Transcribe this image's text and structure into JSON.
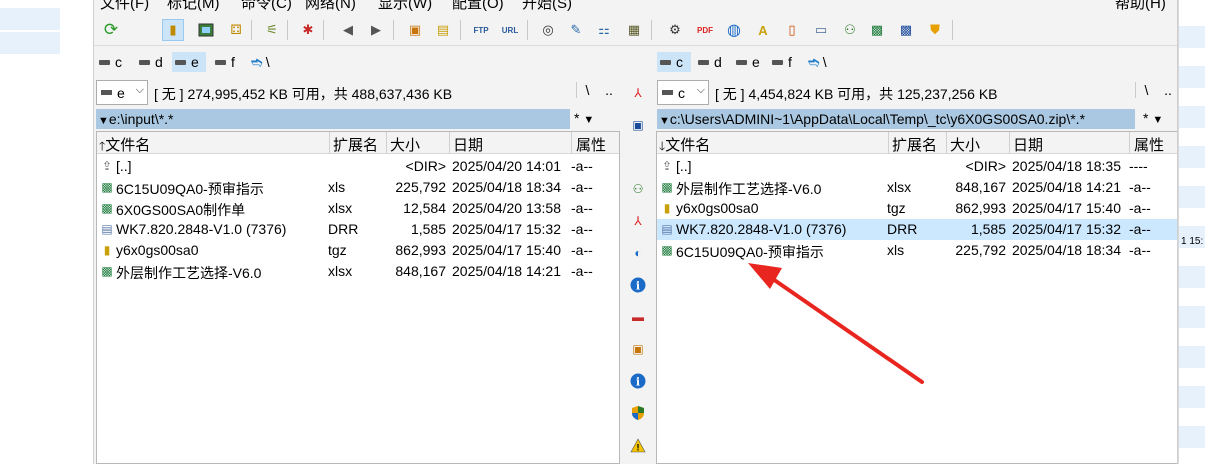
{
  "menu": [
    "文件(F)",
    "标记(M)",
    "命令(C)",
    "网络(N)",
    "显示(W)",
    "配置(O)",
    "开始(S)",
    "帮助(H)"
  ],
  "toolbar_icons": [
    "refresh-icon",
    "view-toggle-icon",
    "thumbnail-icon",
    "tree-icon",
    "compare-icon",
    "invert-selection-icon",
    "back-icon",
    "forward-icon",
    "pack-icon",
    "unpack-icon",
    "ftp-icon",
    "url-icon",
    "find-icon",
    "rename-icon",
    "sync-icon",
    "edit-icon"
  ],
  "right_toolbar_icons": [
    "settings-icon",
    "pdf-icon",
    "globe-icon",
    "font-icon",
    "doc-icon",
    "print-icon",
    "network-icon",
    "excel-icon",
    "word-icon",
    "shield-icon"
  ],
  "ftp_label": "FTP",
  "url_label": "URL",
  "left": {
    "drives": [
      "c",
      "d",
      "e",
      "f",
      "\\"
    ],
    "active_drive": "e",
    "combo": "e",
    "info": "[ 无 ]  274,995,452 KB 可用，共 488,637,436 KB",
    "root_btn": "\\",
    "up_btn": "..",
    "path": "e:\\input\\*.*",
    "filter": "*",
    "headers": {
      "name": "文件名",
      "ext": "扩展名",
      "size": "大小",
      "date": "日期",
      "attr": "属性"
    },
    "rows": [
      {
        "name": "[..]",
        "ext": "",
        "size": "<DIR>",
        "date": "2025/04/20 14:01",
        "attr": "-a--",
        "icon": "up-folder-icon"
      },
      {
        "name": "6C15U09QA0-预审指示",
        "ext": "xls",
        "size": "225,792",
        "date": "2025/04/18 18:34",
        "attr": "-a--",
        "icon": "excel-file-icon"
      },
      {
        "name": "6X0GS00SA0制作单",
        "ext": "xlsx",
        "size": "12,584",
        "date": "2025/04/20 13:58",
        "attr": "-a--",
        "icon": "excel-file-icon"
      },
      {
        "name": "WK7.820.2848-V1.0 (7376)",
        "ext": "DRR",
        "size": "1,585",
        "date": "2025/04/17 15:32",
        "attr": "-a--",
        "icon": "generic-file-icon"
      },
      {
        "name": "y6x0gs00sa0",
        "ext": "tgz",
        "size": "862,993",
        "date": "2025/04/17 15:40",
        "attr": "-a--",
        "icon": "archive-file-icon"
      },
      {
        "name": "外层制作工艺选择-V6.0",
        "ext": "xlsx",
        "size": "848,167",
        "date": "2025/04/18 14:21",
        "attr": "-a--",
        "icon": "excel-file-icon"
      }
    ]
  },
  "right": {
    "drives": [
      "c",
      "d",
      "e",
      "f",
      "\\"
    ],
    "active_drive": "c",
    "combo": "c",
    "info": "[ 无 ]  4,454,824 KB 可用，共 125,237,256 KB",
    "root_btn": "\\",
    "up_btn": "..",
    "path": "c:\\Users\\ADMINI~1\\AppData\\Local\\Temp\\_tc\\y6X0GS00SA0.zip\\*.*",
    "filter": "*",
    "headers": {
      "name": "文件名",
      "ext": "扩展名",
      "size": "大小",
      "date": "日期",
      "attr": "属性"
    },
    "rows": [
      {
        "name": "[..]",
        "ext": "",
        "size": "<DIR>",
        "date": "2025/04/18 18:35",
        "attr": "----",
        "icon": "up-folder-icon"
      },
      {
        "name": "外层制作工艺选择-V6.0",
        "ext": "xlsx",
        "size": "848,167",
        "date": "2025/04/18 14:21",
        "attr": "-a--",
        "icon": "excel-file-icon"
      },
      {
        "name": "y6x0gs00sa0",
        "ext": "tgz",
        "size": "862,993",
        "date": "2025/04/17 15:40",
        "attr": "-a--",
        "icon": "archive-file-icon"
      },
      {
        "name": "WK7.820.2848-V1.0 (7376)",
        "ext": "DRR",
        "size": "1,585",
        "date": "2025/04/17 15:32",
        "attr": "-a--",
        "icon": "generic-file-icon"
      },
      {
        "name": "6C15U09QA0-预审指示",
        "ext": "xls",
        "size": "225,792",
        "date": "2025/04/18 18:34",
        "attr": "-a--",
        "icon": "excel-file-icon"
      }
    ],
    "highlighted_row": 3
  },
  "middle_icons": [
    "pdf-icon",
    "screen-icon",
    "network-icon",
    "pdf-icon",
    "search-icon",
    "info-icon",
    "delete-icon",
    "image-icon",
    "info-icon",
    "shield-icon",
    "warning-icon"
  ],
  "background_right_text": "1 15:",
  "colors": {
    "accent": "#cce4f7",
    "path_bar": "#aac8e1",
    "highlight_row": "#cce8ff",
    "arrow": "#e8261f"
  }
}
